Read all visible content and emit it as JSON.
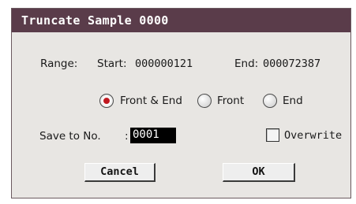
{
  "dialog": {
    "title": "Truncate Sample 0000"
  },
  "range": {
    "label": "Range:",
    "start_label": "Start:",
    "start_value": "000000121",
    "end_label": "End:",
    "end_value": "000072387"
  },
  "mode": {
    "options": [
      {
        "label": "Front & End",
        "selected": true
      },
      {
        "label": "Front",
        "selected": false
      },
      {
        "label": "End",
        "selected": false
      }
    ]
  },
  "save": {
    "label": "Save to No.",
    "colon": ":",
    "value": "0001"
  },
  "overwrite": {
    "label": "Overwrite",
    "checked": false
  },
  "buttons": {
    "cancel": "Cancel",
    "ok": "OK"
  },
  "colors": {
    "titlebar": "#5a3c4a",
    "radio_selected": "#c01820",
    "field_bg": "#000000"
  }
}
